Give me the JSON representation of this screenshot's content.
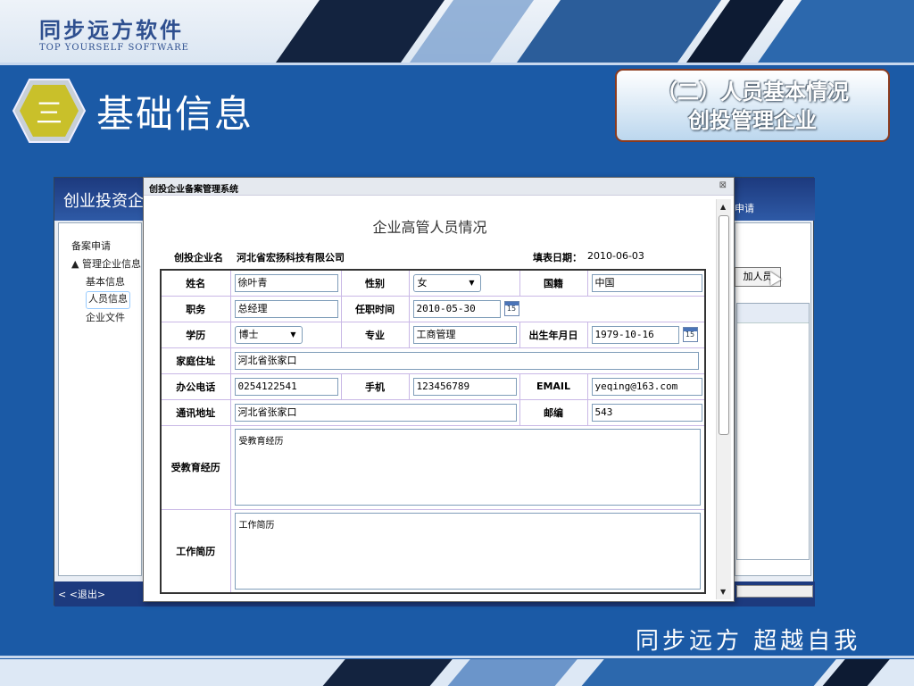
{
  "brand": {
    "cn": "同步远方软件",
    "en": "TOP YOURSELF SOFTWARE"
  },
  "title": {
    "number": "三",
    "text": "基础信息"
  },
  "section": {
    "line1": "（二）人员基本情况",
    "line2": "创投管理企业"
  },
  "bg_app": {
    "title": "创业投资企",
    "tab_apply": "申请",
    "tree": [
      "备案申请",
      "▲ 管理企业信息",
      "基本信息",
      "人员信息",
      "企业文件"
    ],
    "add_button": "加人员",
    "exit": "< <退出>"
  },
  "dialog": {
    "window_title": "创投企业备案管理系统",
    "close": "⊠",
    "form_title": "企业高管人员情况",
    "company_label": "创投企业名",
    "company_value": "河北省宏扬科技有限公司",
    "date_label": "填表日期：",
    "date_value": "2010-06-03",
    "fields": {
      "name_label": "姓名",
      "name_value": "徐叶青",
      "gender_label": "性别",
      "gender_value": "女",
      "nationality_label": "国籍",
      "nationality_value": "中国",
      "position_label": "职务",
      "position_value": "总经理",
      "tenure_label": "任职时间",
      "tenure_value": "2010-05-30",
      "cal_tenure": "15",
      "education_label": "学历",
      "education_value": "博士",
      "major_label": "专业",
      "major_value": "工商管理",
      "birth_label": "出生年月日",
      "birth_value": "1979-10-16",
      "cal_birth": "15",
      "address_label": "家庭住址",
      "address_value": "河北省张家口",
      "office_phone_label": "办公电话",
      "office_phone_value": "0254122541",
      "mobile_label": "手机",
      "mobile_value": "123456789",
      "email_label": "EMAIL",
      "email_value": "yeqing@163.com",
      "mail_address_label": "通讯地址",
      "mail_address_value": "河北省张家口",
      "postcode_label": "邮编",
      "postcode_value": "543",
      "edu_history_label": "受教育经历",
      "edu_history_value": "受教育经历",
      "work_history_label": "工作简历",
      "work_history_value": "工作简历"
    }
  },
  "footer": {
    "slogan": "同步远方  超越自我"
  }
}
